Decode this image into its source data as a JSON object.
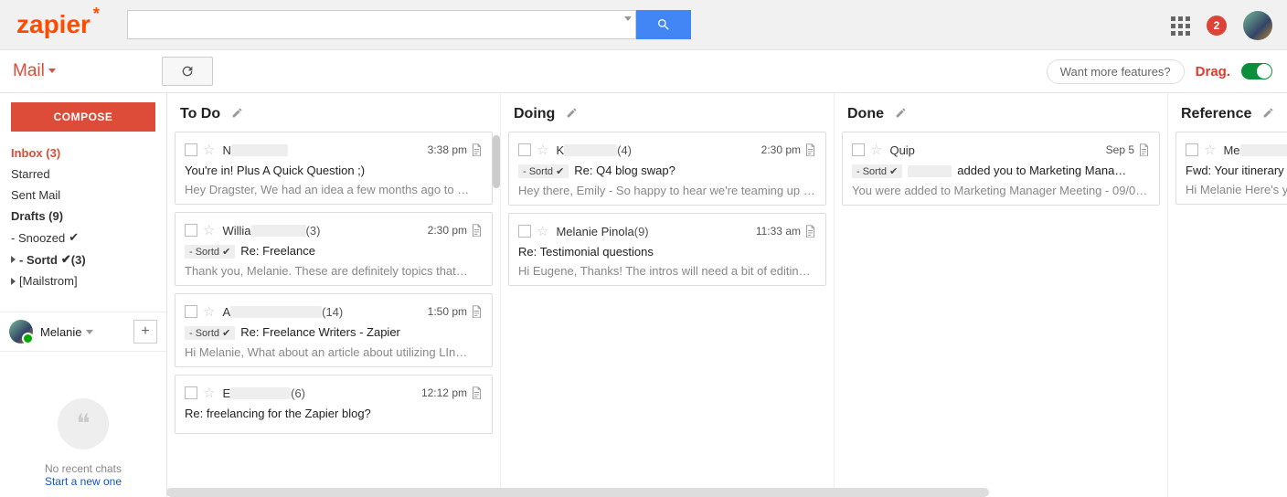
{
  "logo": "zapier",
  "top": {
    "notif_count": "2"
  },
  "toolbar": {
    "mail_label": "Mail",
    "features_label": "Want more features?",
    "drag_label": "Drag."
  },
  "sidebar": {
    "compose": "COMPOSE",
    "items": [
      {
        "label": "Inbox (3)"
      },
      {
        "label": "Starred"
      },
      {
        "label": "Sent Mail"
      },
      {
        "label": "Drafts (9)"
      },
      {
        "label": "- Snoozed",
        "check": true
      },
      {
        "label": "- Sortd",
        "check": true,
        "suffix": " (3)"
      },
      {
        "label": "[Mailstrom]"
      }
    ],
    "user_name": "Melanie",
    "hangouts_line1": "No recent chats",
    "hangouts_line2": "Start a new one"
  },
  "columns": [
    {
      "title": "To Do",
      "cards": [
        {
          "sender_initial": "N",
          "redact_w": 62,
          "count": "",
          "time": "3:38 pm",
          "doc": true,
          "tag": "",
          "subject": "You're in! Plus A Quick Question ;)",
          "preview": "Hey Dragster, We had an idea a few months ago to …"
        },
        {
          "sender_initial": "Willia",
          "redact_w": 60,
          "count": " (3)",
          "time": "2:30 pm",
          "doc": true,
          "tag": "- Sortd ✔",
          "subject": "Re: Freelance",
          "preview": "Thank you, Melanie. These are definitely topics that…"
        },
        {
          "sender_initial": "A",
          "redact_w": 100,
          "count": " (14)",
          "time": "1:50 pm",
          "doc": true,
          "tag": "- Sortd ✔",
          "subject": "Re: Freelance Writers - Zapier",
          "preview": "Hi Melanie, What about an article about utilizing LIn…"
        },
        {
          "sender_initial": "E",
          "redact_w": 66,
          "count": " (6)",
          "time": "12:12 pm",
          "doc": true,
          "tag": "",
          "subject": "Re: freelancing for the Zapier blog?",
          "preview": ""
        }
      ]
    },
    {
      "title": "Doing",
      "cards": [
        {
          "sender_initial": "K",
          "redact_w": 58,
          "count": " (4)",
          "time": "2:30 pm",
          "doc": true,
          "tag": "- Sortd ✔",
          "subject": "Re: Q4 blog swap?",
          "preview": "Hey there, Emily - So happy to hear we're teaming up o…"
        },
        {
          "sender_initial": "Melanie Pinola",
          "redact_w": 0,
          "count": " (9)",
          "time": "11:33 am",
          "doc": true,
          "tag": "",
          "subject": "Re: Testimonial questions",
          "preview": "Hi Eugene, Thanks! The intros will need a bit of editing …"
        }
      ]
    },
    {
      "title": "Done",
      "cards": [
        {
          "sender_initial": "Quip",
          "redact_w": 0,
          "count": "",
          "time": "Sep 5",
          "doc": true,
          "tag": "- Sortd ✔",
          "subject_prefix_redact": 48,
          "subject": "added you to Marketing Mana…",
          "preview": "You were added to Marketing Manager Meeting - 09/06…"
        }
      ]
    },
    {
      "title": "Reference",
      "cards": [
        {
          "sender_initial": "Me",
          "redact_w": 80,
          "count": "",
          "time": "",
          "doc": false,
          "tag": "",
          "subject": "Fwd: Your itinerary for you",
          "preview": "Hi Melanie Here's your flig"
        }
      ]
    }
  ]
}
